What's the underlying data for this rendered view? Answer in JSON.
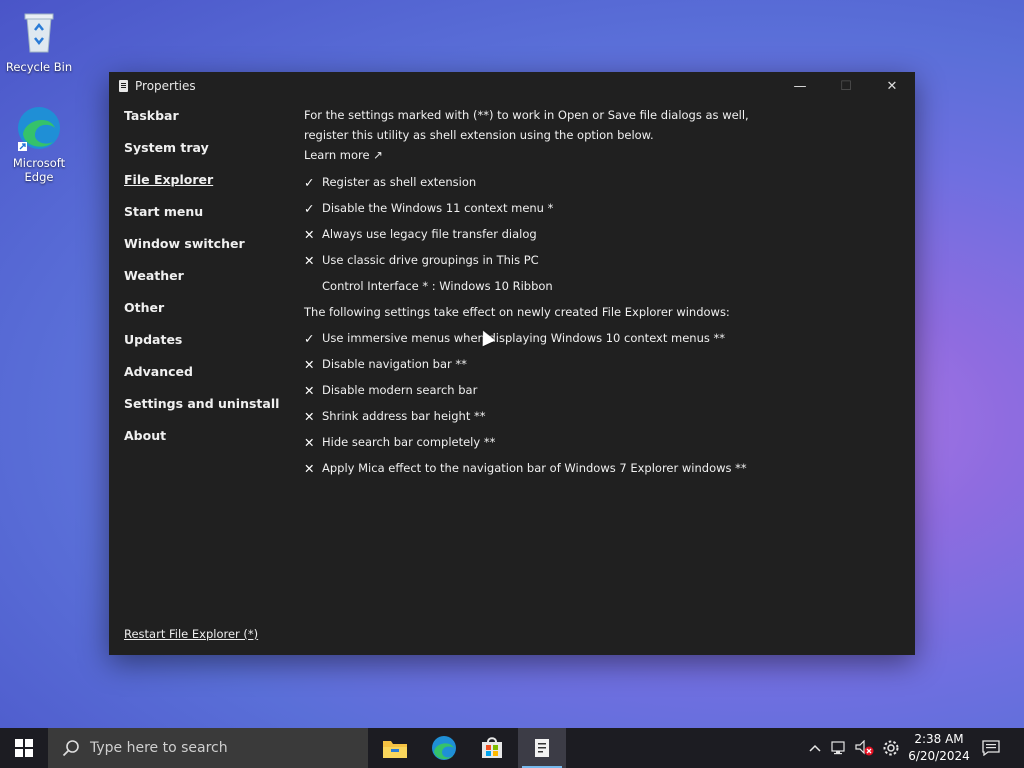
{
  "desktop": {
    "icons": [
      {
        "label": "Recycle Bin"
      },
      {
        "label": "Microsoft Edge"
      }
    ]
  },
  "window": {
    "title": "Properties",
    "controls": {
      "minimize": "—",
      "maximize": "☐",
      "close": "✕"
    },
    "sidebar": {
      "items": [
        {
          "label": "Taskbar"
        },
        {
          "label": "System tray"
        },
        {
          "label": "File Explorer"
        },
        {
          "label": "Start menu"
        },
        {
          "label": "Window switcher"
        },
        {
          "label": "Weather"
        },
        {
          "label": "Other"
        },
        {
          "label": "Updates"
        },
        {
          "label": "Advanced"
        },
        {
          "label": "Settings and uninstall"
        },
        {
          "label": "About"
        }
      ],
      "active_index": 2,
      "footer_link": "Restart File Explorer (*)"
    },
    "content": {
      "intro": "For the settings marked with (**) to work in Open or Save file dialogs as well, register this utility as shell extension using the option below.",
      "learn_more": "Learn more ↗",
      "options_a": [
        {
          "mark": "✓",
          "label": "Register as shell extension",
          "checked": true
        },
        {
          "mark": "✓",
          "label": "Disable the Windows 11 context menu *",
          "checked": true
        },
        {
          "mark": "✕",
          "label": "Always use legacy file transfer dialog",
          "checked": false
        },
        {
          "mark": "✕",
          "label": "Use classic drive groupings in This PC",
          "checked": false
        }
      ],
      "control_interface": "Control Interface * : Windows 10 Ribbon",
      "section_note": "The following settings take effect on newly created File Explorer windows:",
      "options_b": [
        {
          "mark": "✓",
          "label": "Use immersive menus when displaying Windows 10 context menus **",
          "checked": true
        },
        {
          "mark": "✕",
          "label": "Disable navigation bar **",
          "checked": false
        },
        {
          "mark": "✕",
          "label": "Disable modern search bar",
          "checked": false
        },
        {
          "mark": "✕",
          "label": "Shrink address bar height **",
          "checked": false
        },
        {
          "mark": "✕",
          "label": "Hide search bar completely **",
          "checked": false
        },
        {
          "mark": "✕",
          "label": "Apply Mica effect to the navigation bar of Windows 7 Explorer windows **",
          "checked": false
        }
      ]
    }
  },
  "taskbar": {
    "search_placeholder": "Type here to search",
    "apps": [
      {
        "icon": "file-explorer-icon"
      },
      {
        "icon": "edge-icon"
      },
      {
        "icon": "store-icon"
      },
      {
        "icon": "properties-app-icon"
      }
    ],
    "clock": {
      "time": "2:38 AM",
      "date": "6/20/2024"
    }
  }
}
